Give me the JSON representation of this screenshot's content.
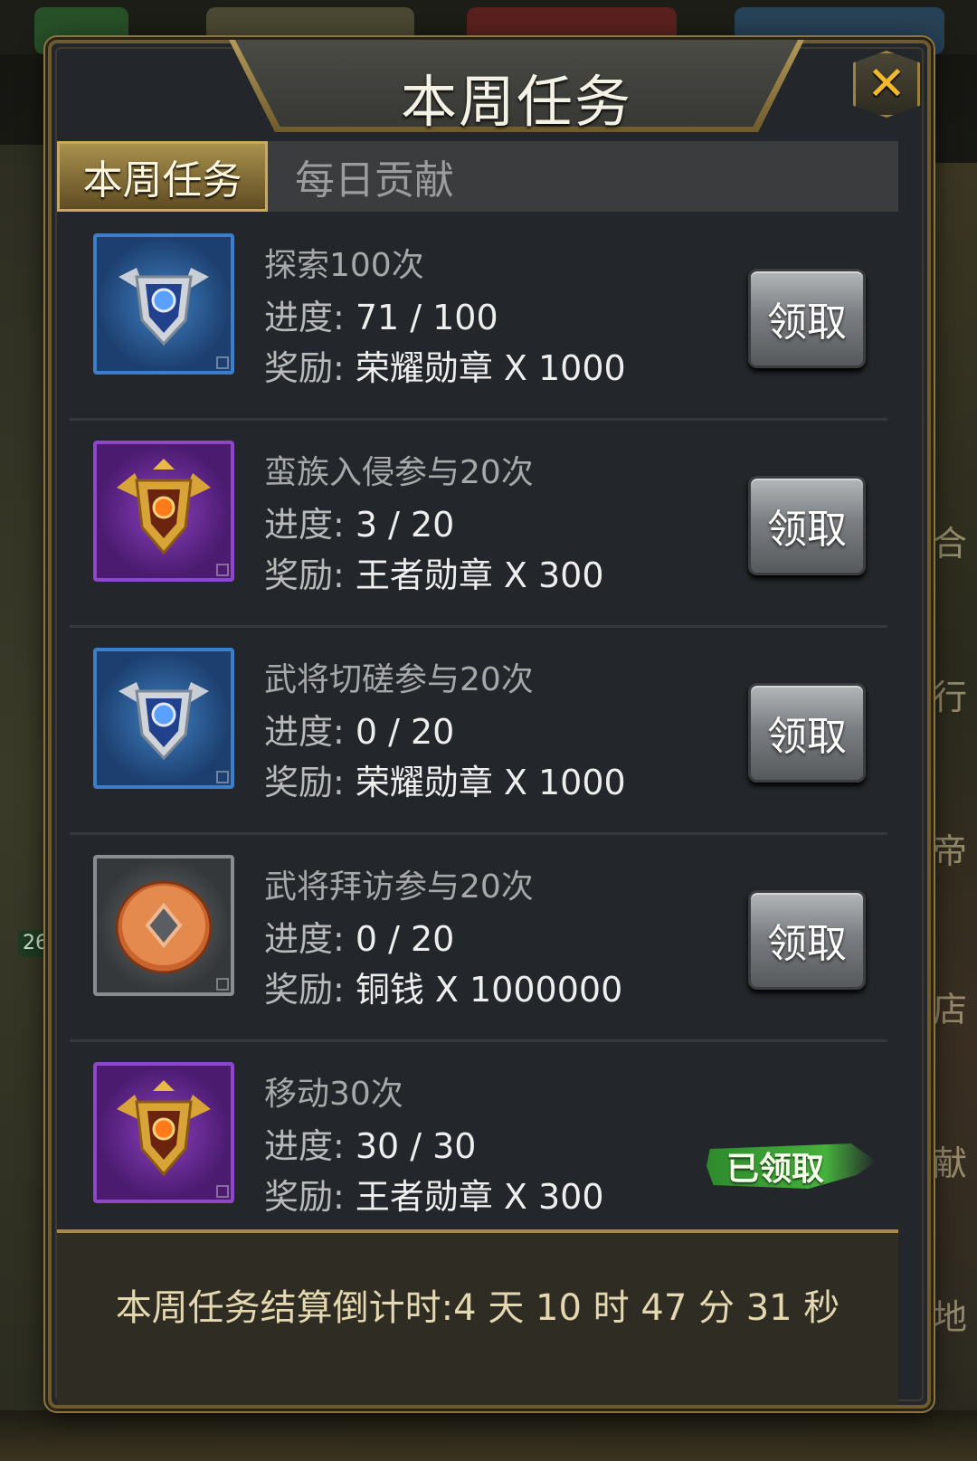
{
  "dialog": {
    "title": "本周任务",
    "close_icon": "close-x-icon"
  },
  "tabs": [
    {
      "label": "本周任务",
      "active": true
    },
    {
      "label": "每日贡献",
      "active": false
    }
  ],
  "labels": {
    "progress": "进度:",
    "reward": "奖励:"
  },
  "tasks": [
    {
      "name": "探索100次",
      "progress": "71 / 100",
      "reward": "荣耀勋章 X 1000",
      "icon": "glory-medal-icon",
      "icon_color": "blue",
      "action": "领取",
      "claimed": false
    },
    {
      "name": "蛮族入侵参与20次",
      "progress": "3 / 20",
      "reward": "王者勋章 X 300",
      "icon": "king-medal-icon",
      "icon_color": "purple",
      "action": "领取",
      "claimed": false
    },
    {
      "name": "武将切磋参与20次",
      "progress": "0 / 20",
      "reward": "荣耀勋章 X 1000",
      "icon": "glory-medal-icon",
      "icon_color": "blue",
      "action": "领取",
      "claimed": false
    },
    {
      "name": "武将拜访参与20次",
      "progress": "0 / 20",
      "reward": "铜钱 X 1000000",
      "icon": "copper-coin-icon",
      "icon_color": "grey",
      "action": "领取",
      "claimed": false
    },
    {
      "name": "移动30次",
      "progress": "30 / 30",
      "reward": "王者勋章 X 300",
      "icon": "king-medal-icon",
      "icon_color": "purple",
      "action": "已领取",
      "claimed": true
    }
  ],
  "footer": {
    "countdown": "本周任务结算倒计时:4 天 10 时 47 分 31 秒"
  },
  "background": {
    "side_glyphs": [
      "合",
      "行",
      "帝",
      "店",
      "献",
      "地"
    ],
    "level": "26"
  }
}
